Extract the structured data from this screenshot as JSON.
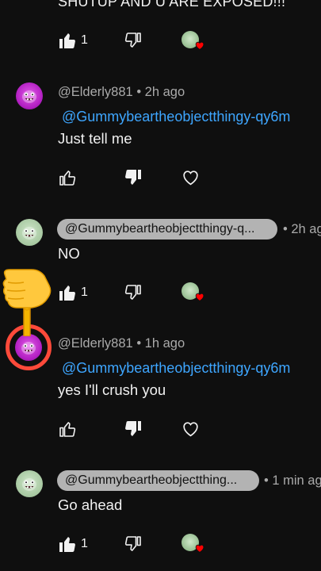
{
  "top_comment": {
    "text": "SHUTUP AND U ARE EXPOSED!!!",
    "like_count": "1"
  },
  "comments": [
    {
      "author": "@Elderly881",
      "time": "• 2h ago",
      "mention": "@Gummybeartheobjectthingy-qy6m",
      "text": "Just tell me"
    },
    {
      "author_chip": "@Gummybeartheobjectthingy-q...",
      "time": "• 2h ag",
      "text": "NO",
      "like_count": "1"
    },
    {
      "author": "@Elderly881",
      "time": "• 1h ago",
      "mention": "@Gummybeartheobjectthingy-qy6m",
      "text": "yes  I'll crush you"
    },
    {
      "author_chip": "@Gummybeartheobjectthing...",
      "time": "• 1 min ag",
      "text": "Go ahead",
      "like_count": "1"
    }
  ],
  "icons": {
    "like": "thumbs-up-icon",
    "dislike": "thumbs-down-icon",
    "heart": "heart-icon",
    "pointer": "pointing-hand-emoji"
  },
  "colors": {
    "background": "#0f0f0f",
    "mention": "#3ea6ff",
    "heart_badge": "#ff0000",
    "highlight_ring": "#ff4a3a"
  }
}
